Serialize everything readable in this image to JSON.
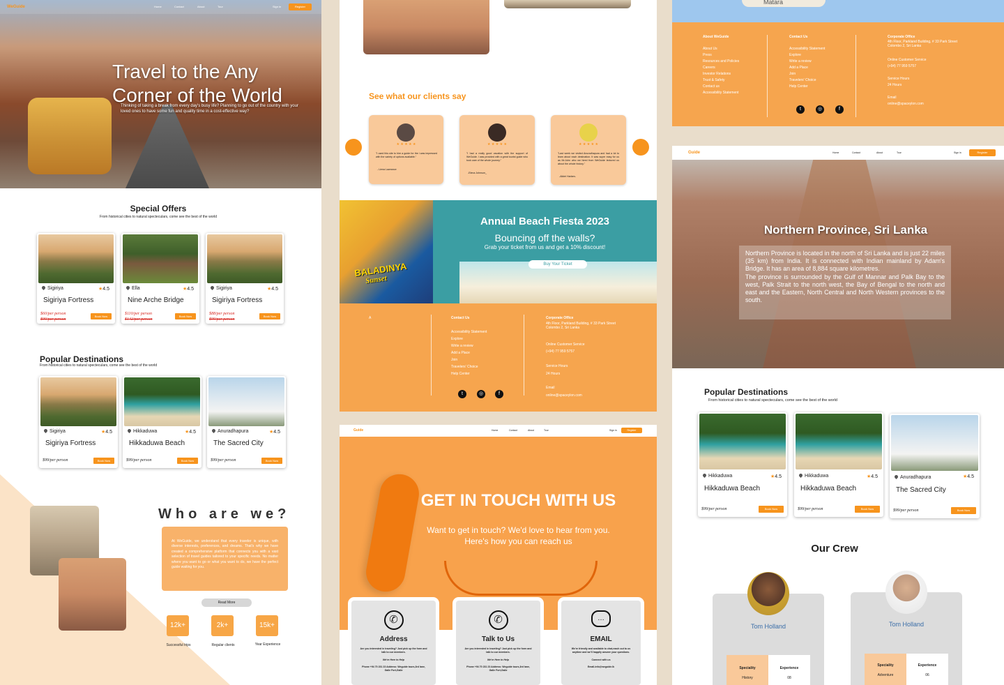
{
  "col1": {
    "nav": {
      "logo": "WeGuide",
      "items": [
        "Home",
        "Contact",
        "About",
        "Tour"
      ],
      "signin": "Sign in",
      "register": "Register"
    },
    "hero": {
      "title_l1": "Travel to the Any",
      "title_l2": "Corner of the World",
      "text": "Thinking of taking a break from every day's busy life? Planning to go out of the country with your loved ones to have some fun and quality time in a cost-effective way?"
    },
    "special": {
      "title": "Special Offers",
      "subtitle": "From historical cities to natural specteculars, come see the best of the world",
      "cards": [
        {
          "loc": "Sigiriya",
          "rating": "4.5",
          "name": "Sigiriya Fortress",
          "price": "$60/per person",
          "old": "$99/per person",
          "book": "Book Now"
        },
        {
          "loc": "Ella",
          "rating": "4.5",
          "name": "Nine Arche Bridge",
          "price": "$110/per person",
          "old": "$142/per person",
          "book": "Book Now"
        },
        {
          "loc": "Sigiriya",
          "rating": "4.5",
          "name": "Sigiriya Fortress",
          "price": "$88/per person",
          "old": "$99/per person",
          "book": "Book Now"
        }
      ]
    },
    "popular": {
      "title": "Popular Destinations",
      "subtitle": "From historical cities to natural specteculars, come see the best of the world",
      "cards": [
        {
          "loc": "Sigiriya",
          "rating": "4.5",
          "name": "Sigiriya Fortress",
          "price": "$99/per person",
          "book": "Book Now"
        },
        {
          "loc": "Hikkaduwa",
          "rating": "4.5",
          "name": "Hikkaduwa Beach",
          "price": "$99/per person",
          "book": "Book Now"
        },
        {
          "loc": "Anuradhapura",
          "rating": "4.5",
          "name": "The Sacred City",
          "price": "$99/per person",
          "book": "Book Now"
        }
      ]
    },
    "who": {
      "title": "Who are we?",
      "text": "At WeGuide, we understand that every traveler is unique, with diverse interests, preferences, and dreams. That's why we have created a comprehensive platform that connects you with a vast selection of travel guides tailored to your specific needs. No matter where you want to go or what you want to do, we have the perfect guide waiting for you.",
      "read_more": "Read More",
      "stats": [
        {
          "value": "12k+",
          "label": "Successful trips"
        },
        {
          "value": "2k+",
          "label": "Regular clients"
        },
        {
          "value": "15k+",
          "label": "Year Experience"
        }
      ]
    }
  },
  "col2": {
    "clients": {
      "title": "See what our clients say",
      "stars": "★ ★ ★ ★ ★",
      "reviews": [
        {
          "text": "\"I used this site to hire a guide for the i was impressed with the variety of options available.\"",
          "author": "- Liena Lawrance"
        },
        {
          "text": "\"I had a really good vacation with the support of WeGuide. I was provided with a great tourist guide who took care of the whole journey.\"",
          "author": "-Elena Johnson_"
        },
        {
          "text": "\"Last week we visited Anuradhapura and had a lot to learn about each destination. It was super easy for us as Mr.John who we hired from WeGuide lectured us about the whole history.\"",
          "author": "-Alidei Harlam-"
        }
      ]
    },
    "promo": {
      "title": "Annual Beach Fiesta 2023",
      "sub": "Bouncing off the walls?",
      "text": "Grab your ticket from us and get a 10% discount!",
      "btn": "Buy Your Ticket",
      "logo_line1": "BALADINYA",
      "logo_line2": "Sunset"
    },
    "footer": {
      "contact_title": "Contact Us",
      "links": [
        "Accessibility Statement",
        "Explore",
        "Write a review",
        "Add a Place",
        "Join",
        "Travelers' Choice",
        "Help Center"
      ],
      "corp_title": "Corporate Office",
      "corp_addr": "4th Floor, Parkland Building, # 33 Park Street Colombo 2, Sri Lanka",
      "service_title": "Online Customer Service",
      "phone": "(+94) 77 959 5757",
      "hours_title": "Service Hours",
      "hours": "24 Hours",
      "email_title": "Email",
      "email": "online@spaceylon.com"
    },
    "nav": {
      "logo": "Guide",
      "items": [
        "Home",
        "Contact",
        "About",
        "Tour"
      ],
      "signin": "Sign in",
      "register": "Register"
    },
    "touch": {
      "title": "GET IN TOUCH WITH US",
      "line1": "Want to get in touch? We'd love to hear from you.",
      "line2": "Here's how you can reach us",
      "cards": [
        {
          "title": "Address",
          "text": "Are you interested in traveling? Just pick up the form and talk to our members.",
          "sub": "We're Here to Help",
          "detail": "Phone +94 70 231 23 Address: Weguide tours,3rd lane, Galle Fort,Galle"
        },
        {
          "title": "Talk to Us",
          "text": "Are you interested in traveling? Just pick up the form and talk to our members.",
          "sub": "We're Here to Help",
          "detail": "Phone +94 70 231 23 Address: Weguide tours,3rd lane, Galle Fort,Galle"
        },
        {
          "title": "EMAIL",
          "text": "We're friendly and available to chat,reach out to us anytime and we'll happily answer your questions.",
          "sub": "Connect with us",
          "detail": "Email-info@weguide.lk"
        }
      ]
    }
  },
  "col3": {
    "map": {
      "label": "Matara"
    },
    "footer": {
      "about_title": "About WeGuide",
      "about_links": [
        "About Us",
        "Press",
        "Resources and Policies",
        "Careers",
        "Investor Relations",
        "Trust & Safety",
        "Contact us",
        "Accessibility Statement"
      ],
      "contact_title": "Contact Us",
      "contact_links": [
        "Accessibility Statement",
        "Explore",
        "Write a review",
        "Add a Place",
        "Join",
        "Travelers' Choice",
        "Help Center"
      ],
      "corp_title": "Corporate Office",
      "corp_addr": "4th Floor, Parkland Building, # 33 Park Street Colombo 2, Sri Lanka",
      "service_title": "Online Customer Service",
      "phone": "(+94) 77 959 5757",
      "hours_title": "Service Hours",
      "hours": "24 Hours",
      "email_title": "Email",
      "email": "online@spaceylon.com"
    },
    "nav": {
      "logo": "Guide",
      "items": [
        "Home",
        "Contact",
        "About",
        "Tour"
      ],
      "signin": "Sign in",
      "register": "Register"
    },
    "province": {
      "title": "Northern Province, Sri Lanka",
      "p1": "Northern Province is located in the north of Sri Lanka and is just 22 miles (35 km) from India. It is connected with Indian mainland by Adam's Bridge. It has an area of 8,884 square kilometres.",
      "p2": "The province is surrounded by the Gulf of Mannar and Palk Bay to the west, Palk Strait to the north west, the Bay of Bengal to the north and east and the Eastern, North Central and North Western provinces to the south."
    },
    "popular": {
      "title": "Popular Destinations",
      "subtitle": "From historical cities to natural specteculars, come see the best of the world",
      "cards": [
        {
          "loc": "Hikkaduwa",
          "rating": "4.5",
          "name": "Hikkaduwa Beach",
          "price": "$99/per person",
          "book": "Book Now"
        },
        {
          "loc": "Hikkaduwa",
          "rating": "4.5",
          "name": "Hikkaduwa Beach",
          "price": "$99/per person",
          "book": "Book Now"
        },
        {
          "loc": "Anuradhapura",
          "rating": "4.5",
          "name": "The Sacred City",
          "price": "$99/per person",
          "book": "Book Now"
        }
      ]
    },
    "crew": {
      "title": "Our Crew",
      "members": [
        {
          "name": "Tom Holland",
          "spec_label": "Speciality",
          "spec": "History",
          "exp_label": "Experience",
          "exp": "08"
        },
        {
          "name": "Tom Holland",
          "spec_label": "Speciality",
          "spec": "Adventure",
          "exp_label": "Experience",
          "exp": "06"
        }
      ]
    }
  },
  "colors": {
    "accent": "#f7941d",
    "footer": "#f6a54e",
    "teal": "#3b9ea3"
  }
}
